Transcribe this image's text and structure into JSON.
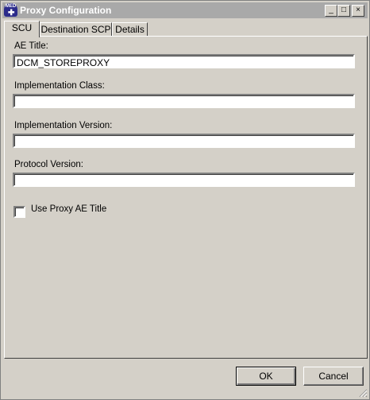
{
  "window": {
    "title": "Proxy Configuration",
    "app_icon_text": "MED",
    "controls": {
      "minimize": "_",
      "maximize": "□",
      "close": "×"
    }
  },
  "tabs": [
    {
      "label": "SCU",
      "active": true
    },
    {
      "label": "Destination SCP",
      "active": false
    },
    {
      "label": "Details",
      "active": false
    }
  ],
  "form": {
    "ae_title": {
      "label": "AE Title:",
      "value": "DCM_STOREPROXY"
    },
    "implementation_class": {
      "label": "Implementation Class:",
      "value": ""
    },
    "implementation_version": {
      "label": "Implementation Version:",
      "value": ""
    },
    "protocol_version": {
      "label": "Protocol Version:",
      "value": ""
    },
    "use_proxy_ae_title": {
      "label": "Use Proxy AE Title",
      "checked": false
    }
  },
  "buttons": {
    "ok": "OK",
    "cancel": "Cancel"
  }
}
